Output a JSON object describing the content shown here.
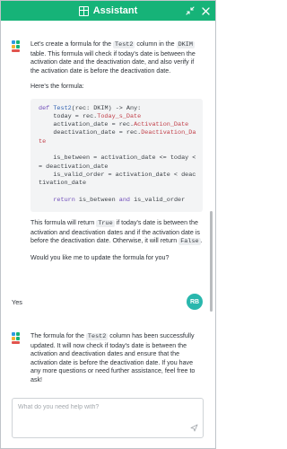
{
  "window": {
    "title": "Assistant",
    "title_icon": "table-icon",
    "minimize_icon": "collapse-arrows-icon",
    "close_icon": "close-icon",
    "brand_color": "#16b378"
  },
  "messages": {
    "first_ai": {
      "intro_before": "Let's create a formula for the ",
      "intro_code1": "Test2",
      "intro_mid": " column in the ",
      "intro_code2": "DKIM",
      "intro_after": " table. This formula will check if today's date is between the activation date and the deactivation date, and also verify if the activation date is before the deactivation date.",
      "heres": "Here's the formula:",
      "code_lines": [
        "def Test2(rec: DKIM) -> Any:",
        "    today = rec.Today_s_Date",
        "    activation_date = rec.Activation_Date",
        "    deactivation_date = rec.Deactivation_Da",
        "te",
        "",
        "    is_between = activation_date <= today <",
        "= deactivation_date",
        "    is_valid_order = activation_date < deac",
        "tivation_date",
        "",
        "    return is_between and is_valid_order"
      ],
      "result_before": "This formula will return ",
      "result_true": "True",
      "result_mid": " if today's date is between the activation and deactivation dates and if the activation date is before the deactivation date. Otherwise, it will return ",
      "result_false": "False",
      "result_after": ".",
      "question": "Would you like me to update the formula for you?"
    },
    "user_reply": {
      "text": "Yes",
      "initials": "RB",
      "avatar_color": "#29b7ad"
    },
    "second_ai": {
      "before": "The formula for the ",
      "code": "Test2",
      "after": " column has been successfully updated. It will now check if today's date is between the activation and deactivation dates and ensure that the activation date is before the deactivation date. If you have any more questions or need further assistance, feel free to ask!"
    }
  },
  "composer": {
    "placeholder": "What do you need help with?",
    "send_icon": "send-icon"
  }
}
